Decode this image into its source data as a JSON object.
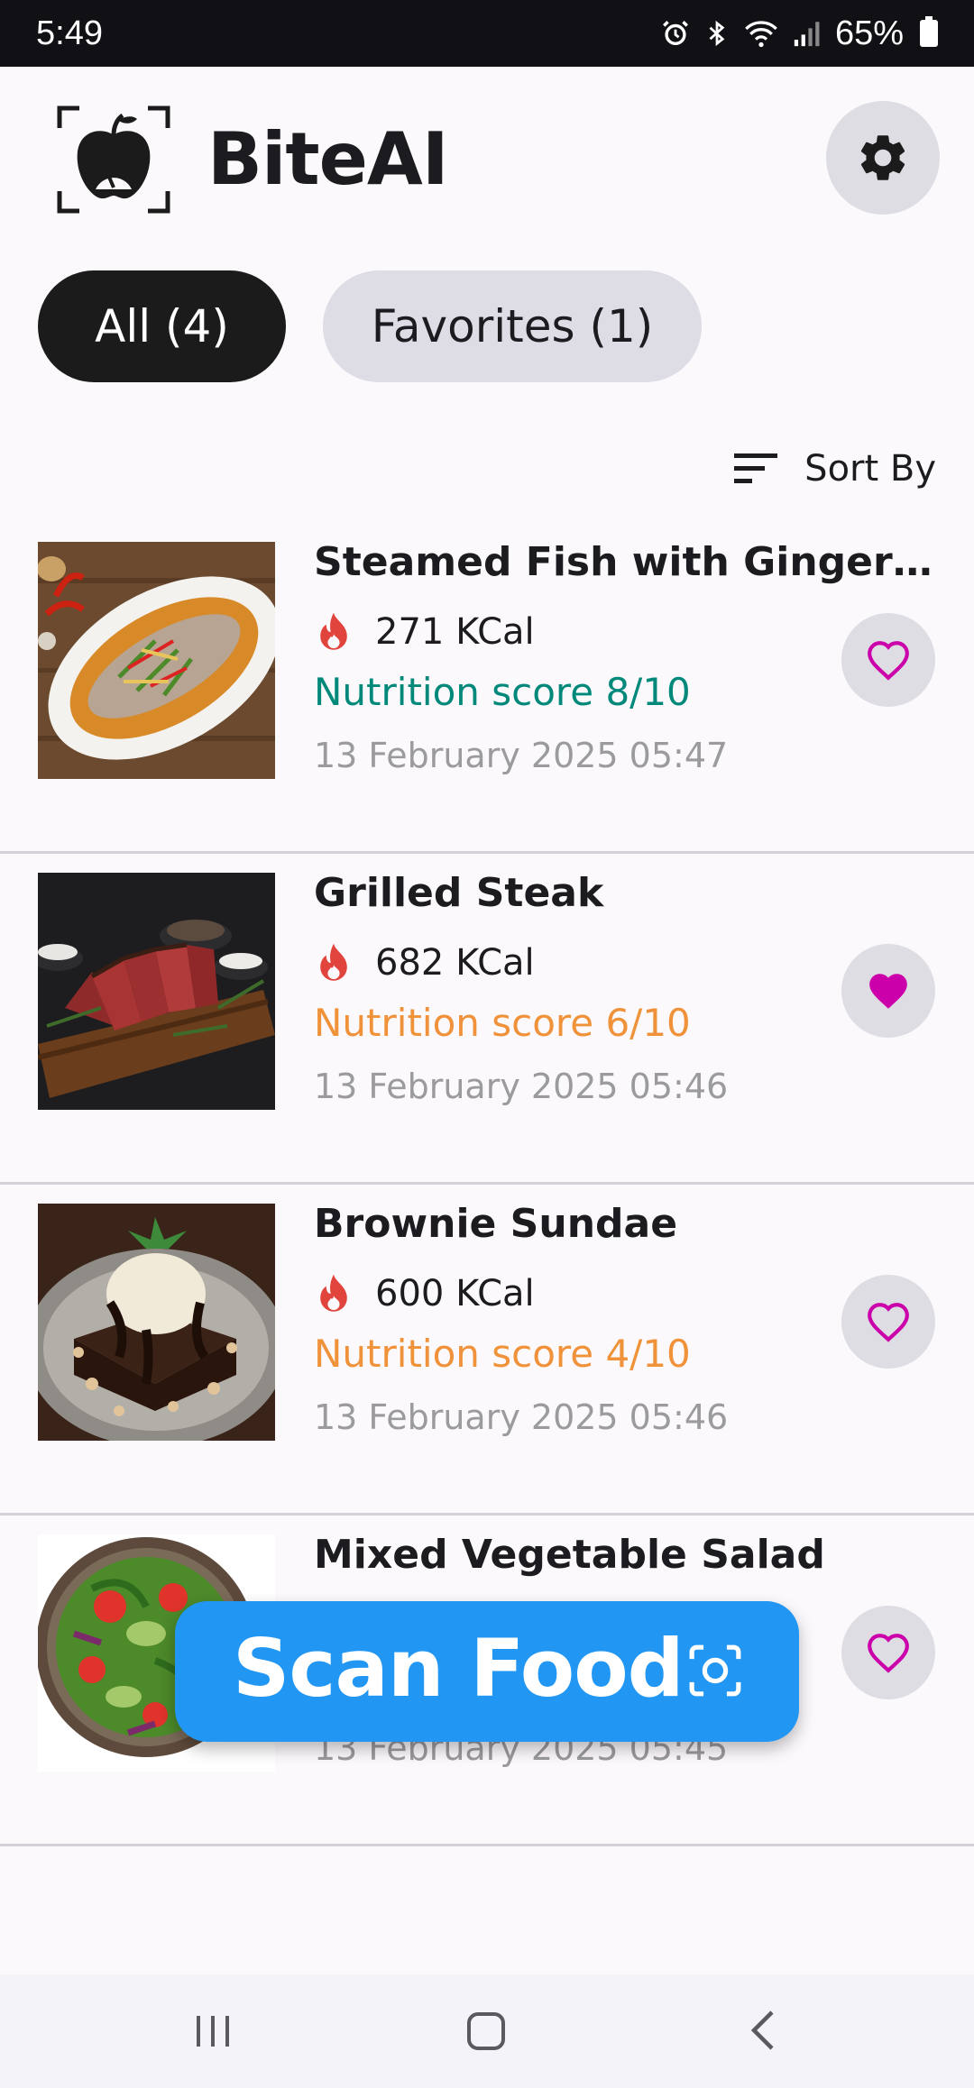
{
  "status_bar": {
    "time": "5:49",
    "battery": "65%"
  },
  "header": {
    "title": "BiteAI"
  },
  "filters": {
    "all_label": "All (4)",
    "favorites_label": "Favorites (1)"
  },
  "sort": {
    "label": "Sort By"
  },
  "foods": [
    {
      "name": "Steamed Fish with Ginger and...",
      "kcal": "271 KCal",
      "score": "Nutrition score 8/10",
      "score_color": "#00897b",
      "date": "13 February 2025 05:47",
      "favorite": false
    },
    {
      "name": "Grilled Steak",
      "kcal": "682 KCal",
      "score": "Nutrition score 6/10",
      "score_color": "#f0923a",
      "date": "13 February 2025 05:46",
      "favorite": true
    },
    {
      "name": "Brownie Sundae",
      "kcal": "600 KCal",
      "score": "Nutrition score 4/10",
      "score_color": "#f0923a",
      "date": "13 February 2025 05:46",
      "favorite": false
    },
    {
      "name": "Mixed Vegetable Salad",
      "kcal": "",
      "score": "",
      "score_color": "#00897b",
      "date": "13 February 2025 05:45",
      "favorite": false
    }
  ],
  "fab": {
    "label": "Scan Food"
  },
  "colors": {
    "accent_blue": "#2196f3",
    "heart_pink": "#cc00aa",
    "flame_red": "#e0443c"
  }
}
